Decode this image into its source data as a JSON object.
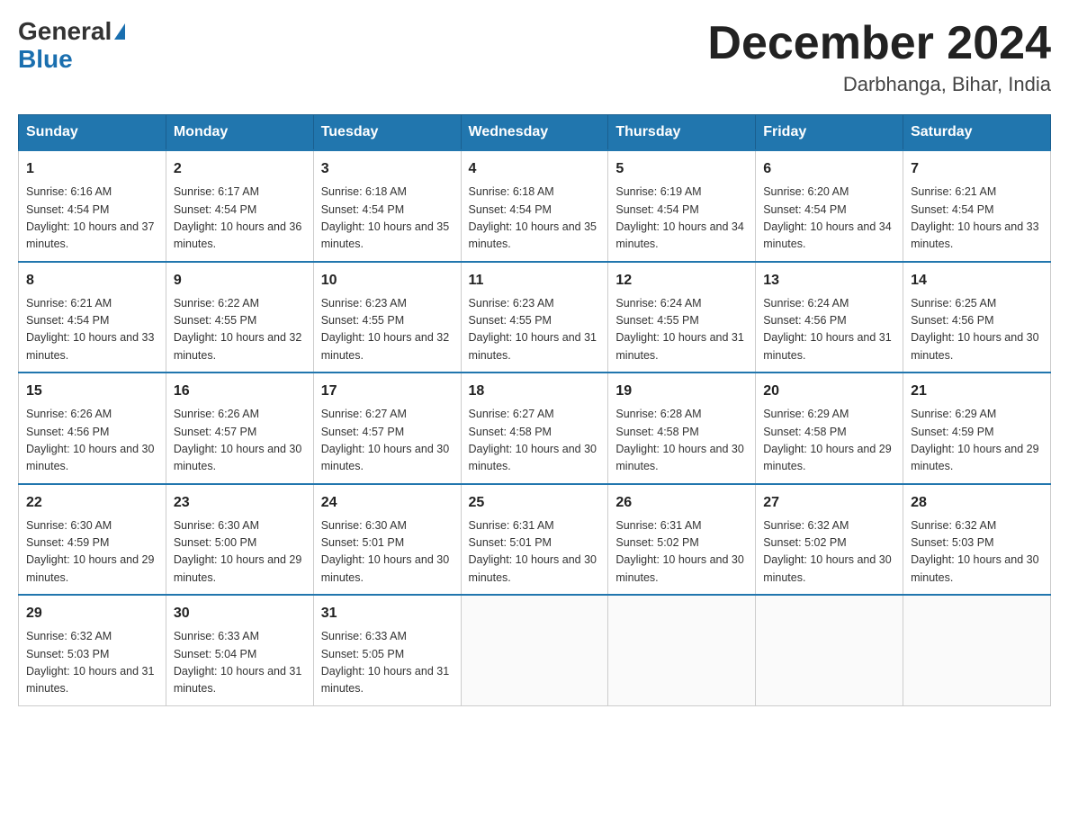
{
  "header": {
    "logo_general": "General",
    "logo_blue": "Blue",
    "title": "December 2024",
    "subtitle": "Darbhanga, Bihar, India"
  },
  "weekdays": [
    "Sunday",
    "Monday",
    "Tuesday",
    "Wednesday",
    "Thursday",
    "Friday",
    "Saturday"
  ],
  "weeks": [
    [
      {
        "day": "1",
        "sunrise": "6:16 AM",
        "sunset": "4:54 PM",
        "daylight": "10 hours and 37 minutes."
      },
      {
        "day": "2",
        "sunrise": "6:17 AM",
        "sunset": "4:54 PM",
        "daylight": "10 hours and 36 minutes."
      },
      {
        "day": "3",
        "sunrise": "6:18 AM",
        "sunset": "4:54 PM",
        "daylight": "10 hours and 35 minutes."
      },
      {
        "day": "4",
        "sunrise": "6:18 AM",
        "sunset": "4:54 PM",
        "daylight": "10 hours and 35 minutes."
      },
      {
        "day": "5",
        "sunrise": "6:19 AM",
        "sunset": "4:54 PM",
        "daylight": "10 hours and 34 minutes."
      },
      {
        "day": "6",
        "sunrise": "6:20 AM",
        "sunset": "4:54 PM",
        "daylight": "10 hours and 34 minutes."
      },
      {
        "day": "7",
        "sunrise": "6:21 AM",
        "sunset": "4:54 PM",
        "daylight": "10 hours and 33 minutes."
      }
    ],
    [
      {
        "day": "8",
        "sunrise": "6:21 AM",
        "sunset": "4:54 PM",
        "daylight": "10 hours and 33 minutes."
      },
      {
        "day": "9",
        "sunrise": "6:22 AM",
        "sunset": "4:55 PM",
        "daylight": "10 hours and 32 minutes."
      },
      {
        "day": "10",
        "sunrise": "6:23 AM",
        "sunset": "4:55 PM",
        "daylight": "10 hours and 32 minutes."
      },
      {
        "day": "11",
        "sunrise": "6:23 AM",
        "sunset": "4:55 PM",
        "daylight": "10 hours and 31 minutes."
      },
      {
        "day": "12",
        "sunrise": "6:24 AM",
        "sunset": "4:55 PM",
        "daylight": "10 hours and 31 minutes."
      },
      {
        "day": "13",
        "sunrise": "6:24 AM",
        "sunset": "4:56 PM",
        "daylight": "10 hours and 31 minutes."
      },
      {
        "day": "14",
        "sunrise": "6:25 AM",
        "sunset": "4:56 PM",
        "daylight": "10 hours and 30 minutes."
      }
    ],
    [
      {
        "day": "15",
        "sunrise": "6:26 AM",
        "sunset": "4:56 PM",
        "daylight": "10 hours and 30 minutes."
      },
      {
        "day": "16",
        "sunrise": "6:26 AM",
        "sunset": "4:57 PM",
        "daylight": "10 hours and 30 minutes."
      },
      {
        "day": "17",
        "sunrise": "6:27 AM",
        "sunset": "4:57 PM",
        "daylight": "10 hours and 30 minutes."
      },
      {
        "day": "18",
        "sunrise": "6:27 AM",
        "sunset": "4:58 PM",
        "daylight": "10 hours and 30 minutes."
      },
      {
        "day": "19",
        "sunrise": "6:28 AM",
        "sunset": "4:58 PM",
        "daylight": "10 hours and 30 minutes."
      },
      {
        "day": "20",
        "sunrise": "6:29 AM",
        "sunset": "4:58 PM",
        "daylight": "10 hours and 29 minutes."
      },
      {
        "day": "21",
        "sunrise": "6:29 AM",
        "sunset": "4:59 PM",
        "daylight": "10 hours and 29 minutes."
      }
    ],
    [
      {
        "day": "22",
        "sunrise": "6:30 AM",
        "sunset": "4:59 PM",
        "daylight": "10 hours and 29 minutes."
      },
      {
        "day": "23",
        "sunrise": "6:30 AM",
        "sunset": "5:00 PM",
        "daylight": "10 hours and 29 minutes."
      },
      {
        "day": "24",
        "sunrise": "6:30 AM",
        "sunset": "5:01 PM",
        "daylight": "10 hours and 30 minutes."
      },
      {
        "day": "25",
        "sunrise": "6:31 AM",
        "sunset": "5:01 PM",
        "daylight": "10 hours and 30 minutes."
      },
      {
        "day": "26",
        "sunrise": "6:31 AM",
        "sunset": "5:02 PM",
        "daylight": "10 hours and 30 minutes."
      },
      {
        "day": "27",
        "sunrise": "6:32 AM",
        "sunset": "5:02 PM",
        "daylight": "10 hours and 30 minutes."
      },
      {
        "day": "28",
        "sunrise": "6:32 AM",
        "sunset": "5:03 PM",
        "daylight": "10 hours and 30 minutes."
      }
    ],
    [
      {
        "day": "29",
        "sunrise": "6:32 AM",
        "sunset": "5:03 PM",
        "daylight": "10 hours and 31 minutes."
      },
      {
        "day": "30",
        "sunrise": "6:33 AM",
        "sunset": "5:04 PM",
        "daylight": "10 hours and 31 minutes."
      },
      {
        "day": "31",
        "sunrise": "6:33 AM",
        "sunset": "5:05 PM",
        "daylight": "10 hours and 31 minutes."
      },
      null,
      null,
      null,
      null
    ]
  ]
}
